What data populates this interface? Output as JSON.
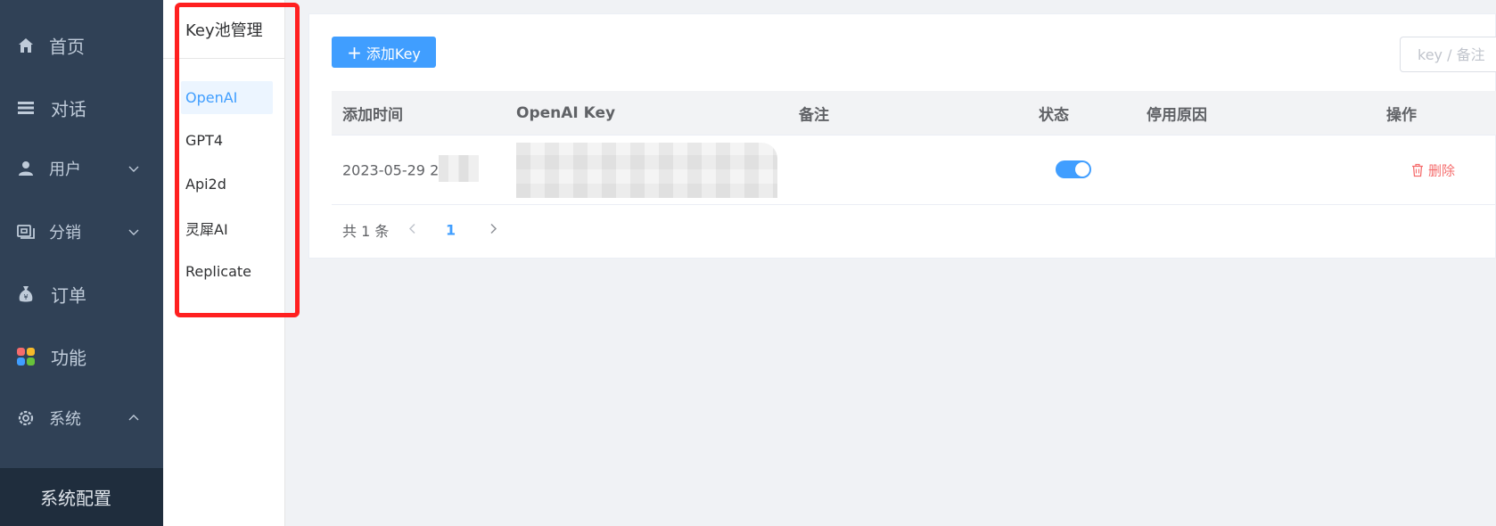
{
  "sidebar": {
    "items": [
      {
        "label": "首页",
        "icon": "home-icon"
      },
      {
        "label": "对话",
        "icon": "list-icon"
      },
      {
        "label": "用户",
        "icon": "user-icon",
        "expand": "chevron-down-icon"
      },
      {
        "label": "分销",
        "icon": "distribution-icon",
        "expand": "chevron-down-icon"
      },
      {
        "label": "订单",
        "icon": "money-bag-icon"
      },
      {
        "label": "功能",
        "icon": "grid-apps-icon"
      },
      {
        "label": "系统",
        "icon": "gear-icon",
        "expand": "chevron-up-icon"
      }
    ],
    "active_sub": "系统配置"
  },
  "subpanel": {
    "title": "Key池管理",
    "items": [
      {
        "label": "OpenAI",
        "active": true
      },
      {
        "label": "GPT4"
      },
      {
        "label": "Api2d"
      },
      {
        "label": "灵犀AI"
      },
      {
        "label": "Replicate"
      }
    ]
  },
  "toolbar": {
    "add_label": "添加Key",
    "search_placeholder": "key / 备注"
  },
  "table": {
    "headers": [
      "添加时间",
      "OpenAI Key",
      "备注",
      "状态",
      "停用原因",
      "操作"
    ],
    "rows": [
      {
        "time": "2023-05-29 23",
        "key": "",
        "note": "",
        "status_on": true,
        "reason": "",
        "action": "删除"
      }
    ]
  },
  "pagination": {
    "total": "共 1 条",
    "current": "1"
  },
  "colors": {
    "sidebar_bg": "#304156",
    "primary": "#409eff",
    "danger": "#f56c6c",
    "highlight_box": "#ff2020"
  }
}
